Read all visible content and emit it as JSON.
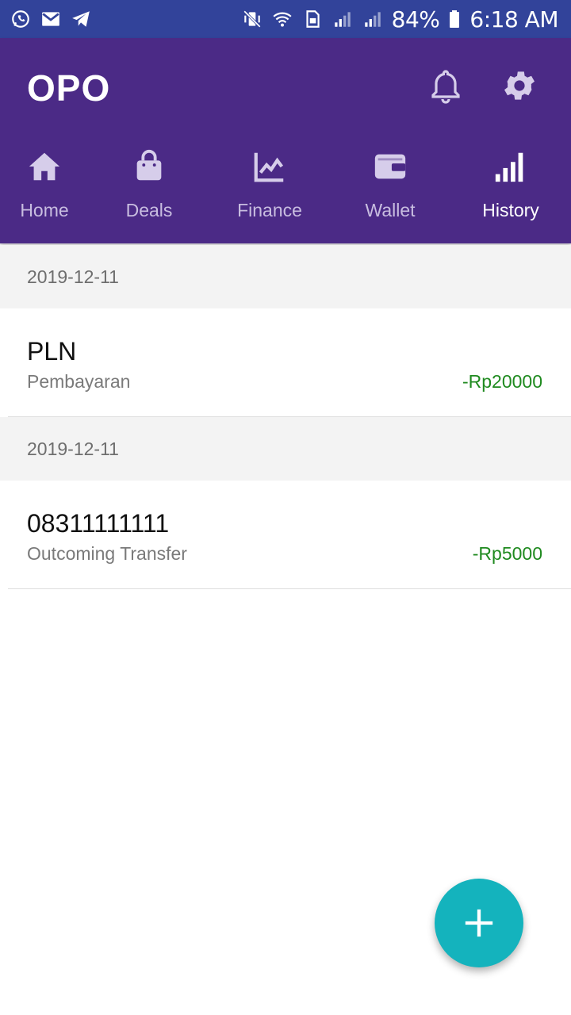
{
  "status_bar": {
    "battery": "84%",
    "time": "6:18 AM",
    "icons_left": [
      "whatsapp-icon",
      "mail-icon",
      "telegram-icon"
    ],
    "icons_right": [
      "vibrate-mute-icon",
      "wifi-icon",
      "sim-icon",
      "signal-icon",
      "signal-icon",
      "battery-icon"
    ]
  },
  "header": {
    "title": "OPO",
    "icons": [
      "bell-icon",
      "gear-icon"
    ]
  },
  "tabs": [
    {
      "label": "Home",
      "icon": "home-icon",
      "active": false
    },
    {
      "label": "Deals",
      "icon": "shopping-bag-icon",
      "active": false
    },
    {
      "label": "Finance",
      "icon": "trending-up-icon",
      "active": false
    },
    {
      "label": "Wallet",
      "icon": "wallet-icon",
      "active": false
    },
    {
      "label": "History",
      "icon": "bar-chart-icon",
      "active": true
    }
  ],
  "history": [
    {
      "date": "2019-12-11",
      "title": "PLN",
      "subtitle": "Pembayaran",
      "amount": "-Rp20000"
    },
    {
      "date": "2019-12-11",
      "title": "08311111111",
      "subtitle": "Outcoming Transfer",
      "amount": "-Rp5000"
    }
  ],
  "colors": {
    "status_bar": "#32439a",
    "header": "#4b2a86",
    "amount": "#1f8a1f",
    "fab": "#14b3bd"
  },
  "fab": {
    "icon": "plus-icon"
  }
}
